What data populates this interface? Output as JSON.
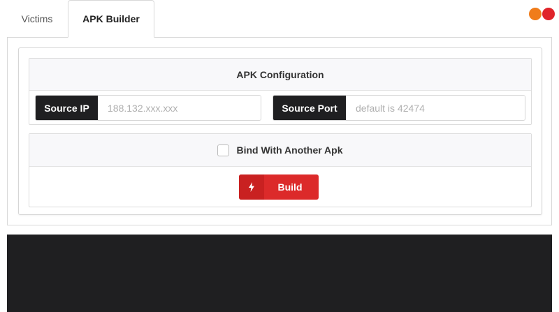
{
  "colors": {
    "dot_orange": "#f07c1a",
    "dot_red": "#e0242a",
    "addon_bg": "#1f1f21",
    "build_red": "#dc2a2a",
    "build_icon_red": "#c92121",
    "console_bg": "#1f1f21"
  },
  "tabs": [
    {
      "label": "Victims",
      "active": false
    },
    {
      "label": "APK Builder",
      "active": true
    }
  ],
  "config": {
    "title": "APK Configuration",
    "source_ip": {
      "label": "Source IP",
      "value": "",
      "placeholder": "188.132.xxx.xxx"
    },
    "source_port": {
      "label": "Source Port",
      "value": "",
      "placeholder": "default is 42474"
    }
  },
  "bind": {
    "label": "Bind With Another Apk",
    "checked": false
  },
  "build": {
    "label": "Build",
    "icon": "bolt-icon"
  },
  "console": {
    "text": ""
  }
}
